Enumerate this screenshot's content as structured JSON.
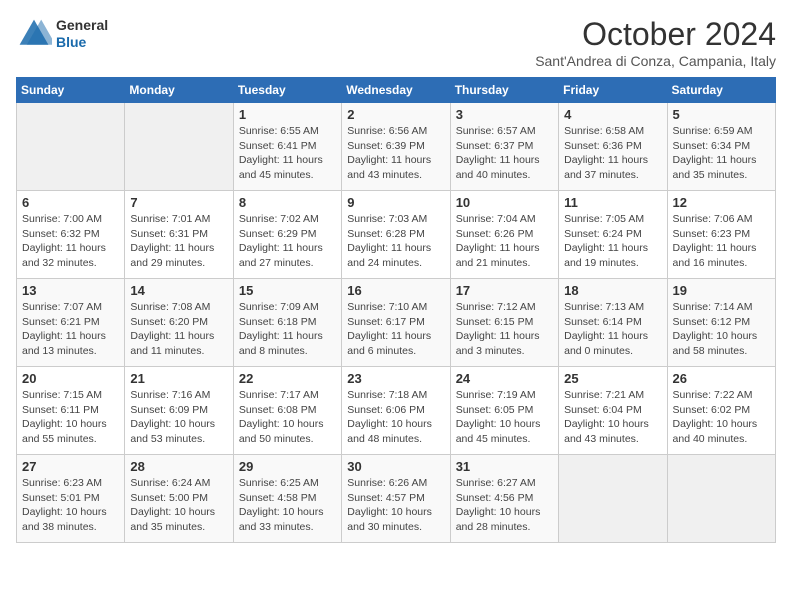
{
  "header": {
    "logo": {
      "general": "General",
      "blue": "Blue"
    },
    "title": "October 2024",
    "location": "Sant'Andrea di Conza, Campania, Italy"
  },
  "calendar": {
    "headers": [
      "Sunday",
      "Monday",
      "Tuesday",
      "Wednesday",
      "Thursday",
      "Friday",
      "Saturday"
    ],
    "weeks": [
      [
        {
          "day": "",
          "empty": true
        },
        {
          "day": "",
          "empty": true
        },
        {
          "day": "1",
          "sunrise": "Sunrise: 6:55 AM",
          "sunset": "Sunset: 6:41 PM",
          "daylight": "Daylight: 11 hours and 45 minutes."
        },
        {
          "day": "2",
          "sunrise": "Sunrise: 6:56 AM",
          "sunset": "Sunset: 6:39 PM",
          "daylight": "Daylight: 11 hours and 43 minutes."
        },
        {
          "day": "3",
          "sunrise": "Sunrise: 6:57 AM",
          "sunset": "Sunset: 6:37 PM",
          "daylight": "Daylight: 11 hours and 40 minutes."
        },
        {
          "day": "4",
          "sunrise": "Sunrise: 6:58 AM",
          "sunset": "Sunset: 6:36 PM",
          "daylight": "Daylight: 11 hours and 37 minutes."
        },
        {
          "day": "5",
          "sunrise": "Sunrise: 6:59 AM",
          "sunset": "Sunset: 6:34 PM",
          "daylight": "Daylight: 11 hours and 35 minutes."
        }
      ],
      [
        {
          "day": "6",
          "sunrise": "Sunrise: 7:00 AM",
          "sunset": "Sunset: 6:32 PM",
          "daylight": "Daylight: 11 hours and 32 minutes."
        },
        {
          "day": "7",
          "sunrise": "Sunrise: 7:01 AM",
          "sunset": "Sunset: 6:31 PM",
          "daylight": "Daylight: 11 hours and 29 minutes."
        },
        {
          "day": "8",
          "sunrise": "Sunrise: 7:02 AM",
          "sunset": "Sunset: 6:29 PM",
          "daylight": "Daylight: 11 hours and 27 minutes."
        },
        {
          "day": "9",
          "sunrise": "Sunrise: 7:03 AM",
          "sunset": "Sunset: 6:28 PM",
          "daylight": "Daylight: 11 hours and 24 minutes."
        },
        {
          "day": "10",
          "sunrise": "Sunrise: 7:04 AM",
          "sunset": "Sunset: 6:26 PM",
          "daylight": "Daylight: 11 hours and 21 minutes."
        },
        {
          "day": "11",
          "sunrise": "Sunrise: 7:05 AM",
          "sunset": "Sunset: 6:24 PM",
          "daylight": "Daylight: 11 hours and 19 minutes."
        },
        {
          "day": "12",
          "sunrise": "Sunrise: 7:06 AM",
          "sunset": "Sunset: 6:23 PM",
          "daylight": "Daylight: 11 hours and 16 minutes."
        }
      ],
      [
        {
          "day": "13",
          "sunrise": "Sunrise: 7:07 AM",
          "sunset": "Sunset: 6:21 PM",
          "daylight": "Daylight: 11 hours and 13 minutes."
        },
        {
          "day": "14",
          "sunrise": "Sunrise: 7:08 AM",
          "sunset": "Sunset: 6:20 PM",
          "daylight": "Daylight: 11 hours and 11 minutes."
        },
        {
          "day": "15",
          "sunrise": "Sunrise: 7:09 AM",
          "sunset": "Sunset: 6:18 PM",
          "daylight": "Daylight: 11 hours and 8 minutes."
        },
        {
          "day": "16",
          "sunrise": "Sunrise: 7:10 AM",
          "sunset": "Sunset: 6:17 PM",
          "daylight": "Daylight: 11 hours and 6 minutes."
        },
        {
          "day": "17",
          "sunrise": "Sunrise: 7:12 AM",
          "sunset": "Sunset: 6:15 PM",
          "daylight": "Daylight: 11 hours and 3 minutes."
        },
        {
          "day": "18",
          "sunrise": "Sunrise: 7:13 AM",
          "sunset": "Sunset: 6:14 PM",
          "daylight": "Daylight: 11 hours and 0 minutes."
        },
        {
          "day": "19",
          "sunrise": "Sunrise: 7:14 AM",
          "sunset": "Sunset: 6:12 PM",
          "daylight": "Daylight: 10 hours and 58 minutes."
        }
      ],
      [
        {
          "day": "20",
          "sunrise": "Sunrise: 7:15 AM",
          "sunset": "Sunset: 6:11 PM",
          "daylight": "Daylight: 10 hours and 55 minutes."
        },
        {
          "day": "21",
          "sunrise": "Sunrise: 7:16 AM",
          "sunset": "Sunset: 6:09 PM",
          "daylight": "Daylight: 10 hours and 53 minutes."
        },
        {
          "day": "22",
          "sunrise": "Sunrise: 7:17 AM",
          "sunset": "Sunset: 6:08 PM",
          "daylight": "Daylight: 10 hours and 50 minutes."
        },
        {
          "day": "23",
          "sunrise": "Sunrise: 7:18 AM",
          "sunset": "Sunset: 6:06 PM",
          "daylight": "Daylight: 10 hours and 48 minutes."
        },
        {
          "day": "24",
          "sunrise": "Sunrise: 7:19 AM",
          "sunset": "Sunset: 6:05 PM",
          "daylight": "Daylight: 10 hours and 45 minutes."
        },
        {
          "day": "25",
          "sunrise": "Sunrise: 7:21 AM",
          "sunset": "Sunset: 6:04 PM",
          "daylight": "Daylight: 10 hours and 43 minutes."
        },
        {
          "day": "26",
          "sunrise": "Sunrise: 7:22 AM",
          "sunset": "Sunset: 6:02 PM",
          "daylight": "Daylight: 10 hours and 40 minutes."
        }
      ],
      [
        {
          "day": "27",
          "sunrise": "Sunrise: 6:23 AM",
          "sunset": "Sunset: 5:01 PM",
          "daylight": "Daylight: 10 hours and 38 minutes."
        },
        {
          "day": "28",
          "sunrise": "Sunrise: 6:24 AM",
          "sunset": "Sunset: 5:00 PM",
          "daylight": "Daylight: 10 hours and 35 minutes."
        },
        {
          "day": "29",
          "sunrise": "Sunrise: 6:25 AM",
          "sunset": "Sunset: 4:58 PM",
          "daylight": "Daylight: 10 hours and 33 minutes."
        },
        {
          "day": "30",
          "sunrise": "Sunrise: 6:26 AM",
          "sunset": "Sunset: 4:57 PM",
          "daylight": "Daylight: 10 hours and 30 minutes."
        },
        {
          "day": "31",
          "sunrise": "Sunrise: 6:27 AM",
          "sunset": "Sunset: 4:56 PM",
          "daylight": "Daylight: 10 hours and 28 minutes."
        },
        {
          "day": "",
          "empty": true
        },
        {
          "day": "",
          "empty": true
        }
      ]
    ]
  }
}
